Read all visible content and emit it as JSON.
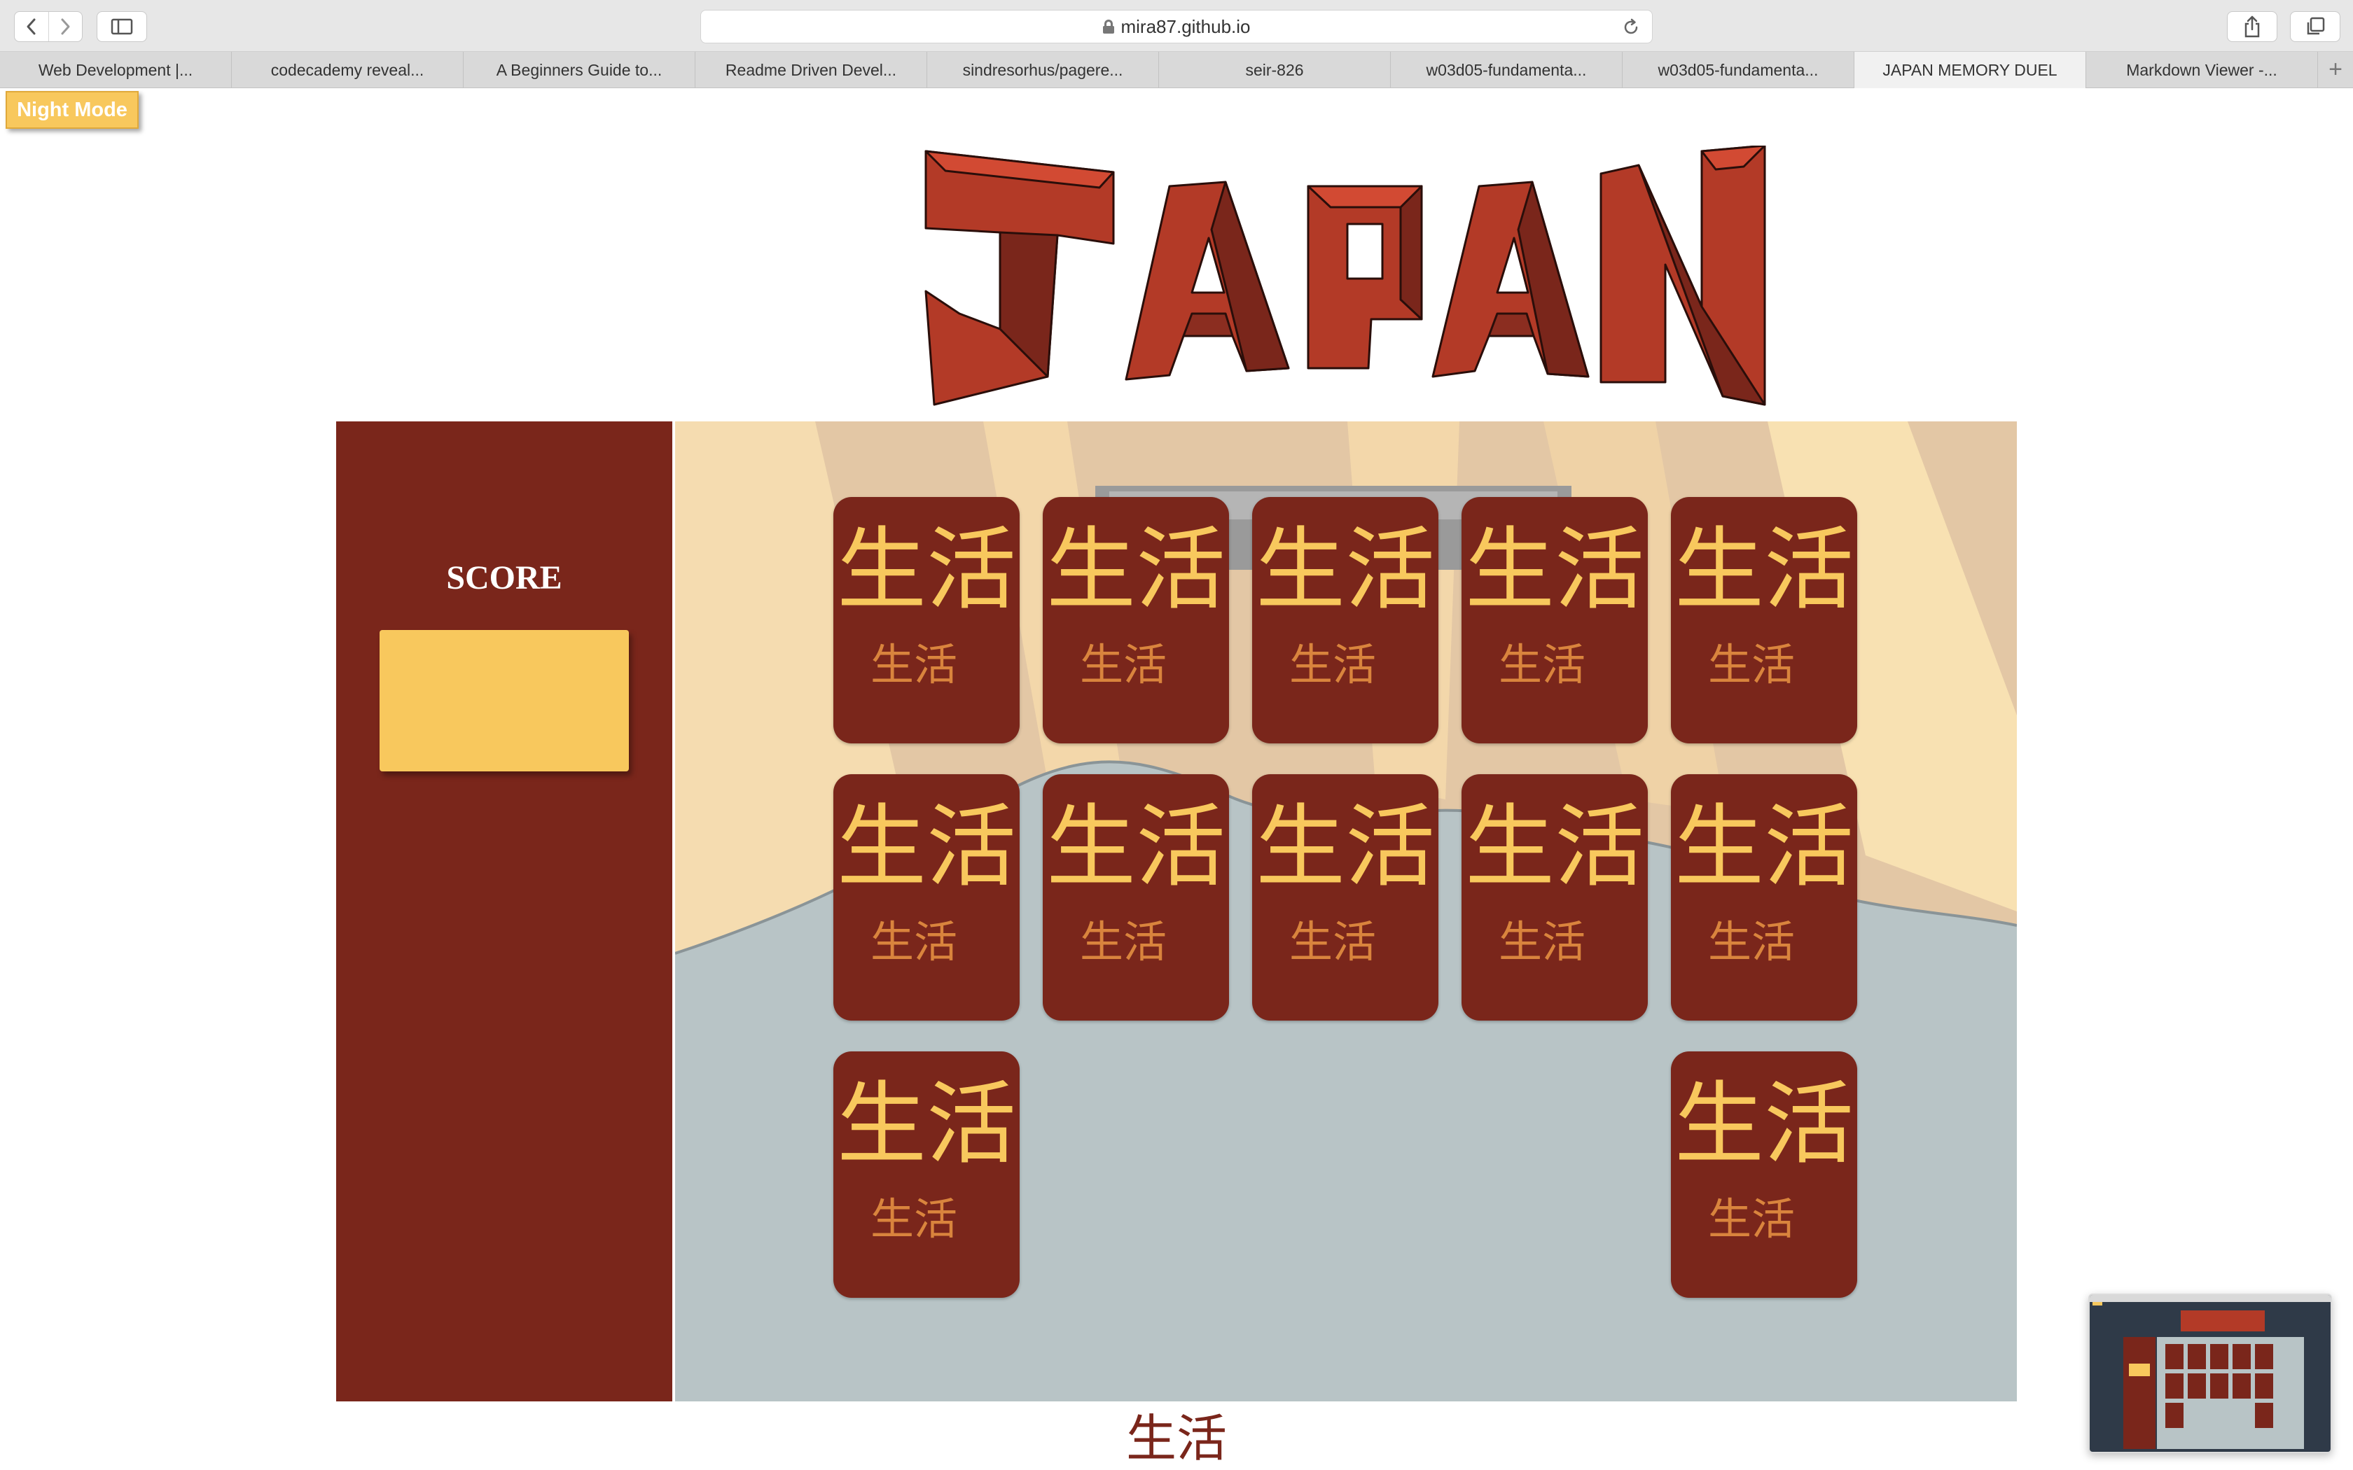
{
  "browser": {
    "url": "mira87.github.io",
    "tabs": [
      {
        "label": "Web Development |..."
      },
      {
        "label": "codecademy reveal..."
      },
      {
        "label": "A Beginners Guide to..."
      },
      {
        "label": "Readme Driven Devel..."
      },
      {
        "label": "sindresorhus/pagere..."
      },
      {
        "label": "seir-826"
      },
      {
        "label": "w03d05-fundamenta..."
      },
      {
        "label": "w03d05-fundamenta..."
      },
      {
        "label": "JAPAN MEMORY DUEL"
      },
      {
        "label": "Markdown Viewer -..."
      }
    ],
    "active_tab": 8,
    "add_tab_label": "+"
  },
  "page": {
    "night_mode_label": "Night Mode",
    "logo_text": "JAPAN",
    "score": {
      "title": "SCORE",
      "value": ""
    },
    "cards": [
      {
        "big": "生活",
        "small": "生活"
      },
      {
        "big": "生活",
        "small": "生活"
      },
      {
        "big": "生活",
        "small": "生活"
      },
      {
        "big": "生活",
        "small": "生活"
      },
      {
        "big": "生活",
        "small": "生活"
      },
      {
        "big": "生活",
        "small": "生活"
      },
      {
        "big": "生活",
        "small": "生活"
      },
      {
        "big": "生活",
        "small": "生活"
      },
      {
        "big": "生活",
        "small": "生活"
      },
      {
        "big": "生活",
        "small": "生活"
      },
      {
        "big": "生活",
        "small": "生活"
      },
      {
        "big": "生活",
        "small": "生活"
      }
    ],
    "footer_text": "生活"
  },
  "colors": {
    "brand_red": "#7a261b",
    "logo_red": "#b33a27",
    "accent_yellow": "#f8c85d",
    "kanji_orange": "#d9843d",
    "board_gray": "#b8c4c6"
  },
  "icons": [
    "back-icon",
    "forward-icon",
    "sidebar-icon",
    "lock-icon",
    "reload-icon",
    "share-icon",
    "tabs-overview-icon",
    "add-tab-icon"
  ]
}
